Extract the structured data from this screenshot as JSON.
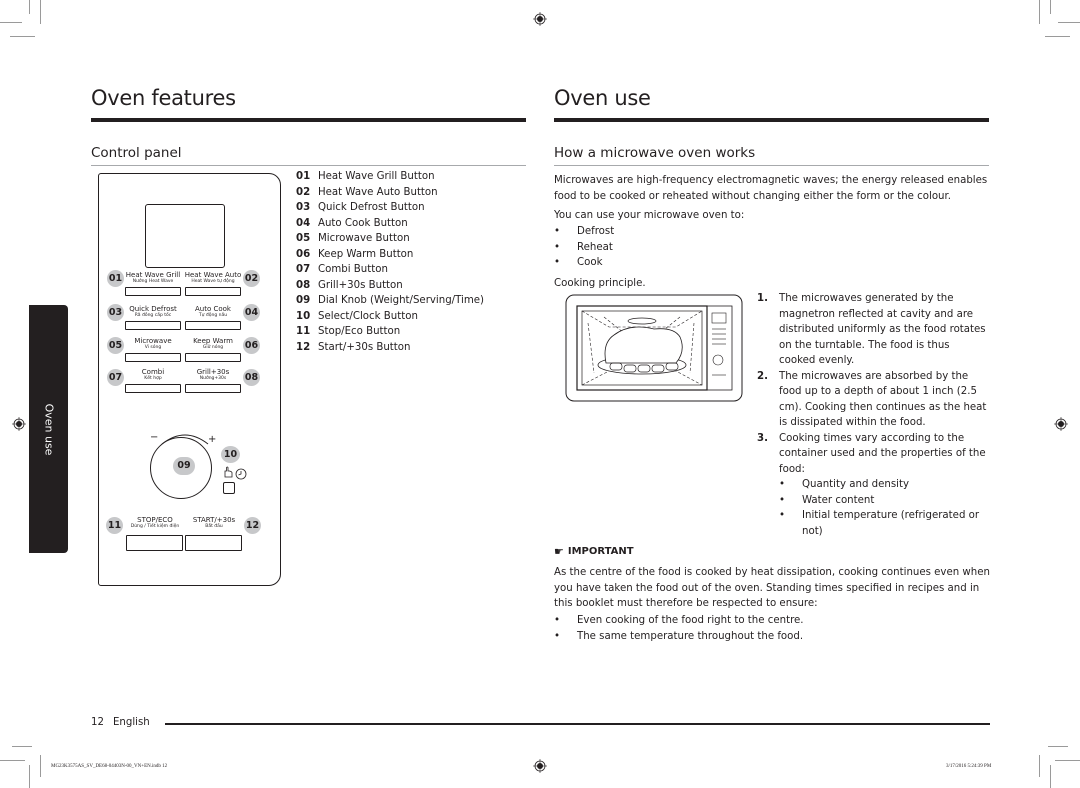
{
  "left_page": {
    "title": "Oven features",
    "section_title": "Control panel",
    "side_tab": "Oven use",
    "panel": {
      "buttons": [
        {
          "num": "01",
          "label": "Heat Wave Grill",
          "sub": "Nướng Heat Wave"
        },
        {
          "num": "02",
          "label": "Heat Wave Auto",
          "sub": "Heat Wave tự động"
        },
        {
          "num": "03",
          "label": "Quick Defrost",
          "sub": "Rã đông cấp tốc"
        },
        {
          "num": "04",
          "label": "Auto Cook",
          "sub": "Tự động nấu"
        },
        {
          "num": "05",
          "label": "Microwave",
          "sub": "Vi sóng"
        },
        {
          "num": "06",
          "label": "Keep Warm",
          "sub": "Giữ nóng"
        },
        {
          "num": "07",
          "label": "Combi",
          "sub": "Kết hợp"
        },
        {
          "num": "08",
          "label": "Grill+30s",
          "sub": "Nướng+30s"
        },
        {
          "num": "11",
          "label": "STOP/ECO",
          "sub": "Dừng / Tiết kiệm điện"
        },
        {
          "num": "12",
          "label": "START/+30s",
          "sub": "Bắt đầu"
        }
      ],
      "dial_num": "09",
      "select_num": "10",
      "dial_minus": "−",
      "dial_plus": "+"
    },
    "legend": [
      {
        "num": "01",
        "label": "Heat Wave Grill Button"
      },
      {
        "num": "02",
        "label": "Heat Wave Auto Button"
      },
      {
        "num": "03",
        "label": "Quick Defrost Button"
      },
      {
        "num": "04",
        "label": "Auto Cook Button"
      },
      {
        "num": "05",
        "label": "Microwave Button"
      },
      {
        "num": "06",
        "label": "Keep Warm Button"
      },
      {
        "num": "07",
        "label": "Combi Button"
      },
      {
        "num": "08",
        "label": "Grill+30s Button"
      },
      {
        "num": "09",
        "label": "Dial Knob (Weight/Serving/Time)"
      },
      {
        "num": "10",
        "label": "Select/Clock Button"
      },
      {
        "num": "11",
        "label": "Stop/Eco Button"
      },
      {
        "num": "12",
        "label": "Start/+30s Button"
      }
    ],
    "page_number": "12",
    "language": "English"
  },
  "right_page": {
    "title": "Oven use",
    "section_title": "How a microwave oven works",
    "intro": "Microwaves are high-frequency electromagnetic waves; the energy released enables food to be cooked or reheated without changing either the form or the colour.",
    "uses_intro": "You can use your microwave oven to:",
    "uses": [
      "Defrost",
      "Reheat",
      "Cook"
    ],
    "principle_label": "Cooking principle.",
    "steps": [
      {
        "num": "1.",
        "text": "The microwaves generated by the magnetron reflected at cavity and are distributed uniformly as the food rotates on the turntable. The food is thus cooked evenly."
      },
      {
        "num": "2.",
        "text": "The microwaves are absorbed by the food up to a depth of about 1 inch (2.5 cm). Cooking then continues as the heat is dissipated within the food."
      },
      {
        "num": "3.",
        "text": "Cooking times vary according to the container used and the properties of the food:"
      }
    ],
    "properties": [
      "Quantity and density",
      "Water content",
      "Initial temperature (refrigerated or not)"
    ],
    "important_label": "IMPORTANT",
    "important_text": "As the centre of the food is cooked by heat dissipation, cooking continues even when you have taken the food out of the oven. Standing times specified in recipes and in this booklet must therefore be respected to ensure:",
    "important_points": [
      "Even cooking of the food right to the centre.",
      "The same temperature throughout the food."
    ]
  },
  "print_footer": {
    "file": "MG23K3575AS_SV_DE68-04403N-00_VN+EN.indb   12",
    "timestamp": "3/17/2016   5:24:39 PM"
  }
}
